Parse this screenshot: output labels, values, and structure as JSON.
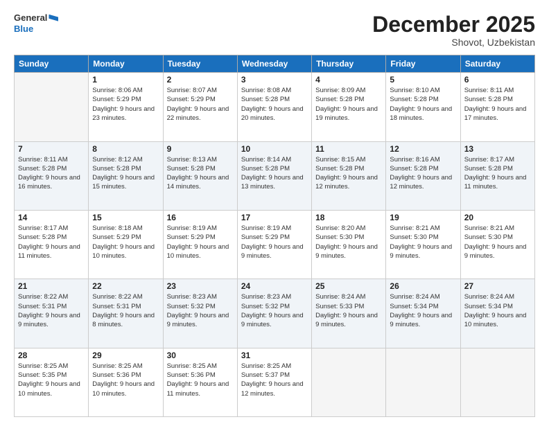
{
  "header": {
    "logo_general": "General",
    "logo_blue": "Blue",
    "month_title": "December 2025",
    "location": "Shovot, Uzbekistan"
  },
  "weekdays": [
    "Sunday",
    "Monday",
    "Tuesday",
    "Wednesday",
    "Thursday",
    "Friday",
    "Saturday"
  ],
  "weeks": [
    [
      {
        "num": "",
        "info": ""
      },
      {
        "num": "1",
        "info": "Sunrise: 8:06 AM\nSunset: 5:29 PM\nDaylight: 9 hours\nand 23 minutes."
      },
      {
        "num": "2",
        "info": "Sunrise: 8:07 AM\nSunset: 5:29 PM\nDaylight: 9 hours\nand 22 minutes."
      },
      {
        "num": "3",
        "info": "Sunrise: 8:08 AM\nSunset: 5:28 PM\nDaylight: 9 hours\nand 20 minutes."
      },
      {
        "num": "4",
        "info": "Sunrise: 8:09 AM\nSunset: 5:28 PM\nDaylight: 9 hours\nand 19 minutes."
      },
      {
        "num": "5",
        "info": "Sunrise: 8:10 AM\nSunset: 5:28 PM\nDaylight: 9 hours\nand 18 minutes."
      },
      {
        "num": "6",
        "info": "Sunrise: 8:11 AM\nSunset: 5:28 PM\nDaylight: 9 hours\nand 17 minutes."
      }
    ],
    [
      {
        "num": "7",
        "info": "Sunrise: 8:11 AM\nSunset: 5:28 PM\nDaylight: 9 hours\nand 16 minutes."
      },
      {
        "num": "8",
        "info": "Sunrise: 8:12 AM\nSunset: 5:28 PM\nDaylight: 9 hours\nand 15 minutes."
      },
      {
        "num": "9",
        "info": "Sunrise: 8:13 AM\nSunset: 5:28 PM\nDaylight: 9 hours\nand 14 minutes."
      },
      {
        "num": "10",
        "info": "Sunrise: 8:14 AM\nSunset: 5:28 PM\nDaylight: 9 hours\nand 13 minutes."
      },
      {
        "num": "11",
        "info": "Sunrise: 8:15 AM\nSunset: 5:28 PM\nDaylight: 9 hours\nand 12 minutes."
      },
      {
        "num": "12",
        "info": "Sunrise: 8:16 AM\nSunset: 5:28 PM\nDaylight: 9 hours\nand 12 minutes."
      },
      {
        "num": "13",
        "info": "Sunrise: 8:17 AM\nSunset: 5:28 PM\nDaylight: 9 hours\nand 11 minutes."
      }
    ],
    [
      {
        "num": "14",
        "info": "Sunrise: 8:17 AM\nSunset: 5:28 PM\nDaylight: 9 hours\nand 11 minutes."
      },
      {
        "num": "15",
        "info": "Sunrise: 8:18 AM\nSunset: 5:29 PM\nDaylight: 9 hours\nand 10 minutes."
      },
      {
        "num": "16",
        "info": "Sunrise: 8:19 AM\nSunset: 5:29 PM\nDaylight: 9 hours\nand 10 minutes."
      },
      {
        "num": "17",
        "info": "Sunrise: 8:19 AM\nSunset: 5:29 PM\nDaylight: 9 hours\nand 9 minutes."
      },
      {
        "num": "18",
        "info": "Sunrise: 8:20 AM\nSunset: 5:30 PM\nDaylight: 9 hours\nand 9 minutes."
      },
      {
        "num": "19",
        "info": "Sunrise: 8:21 AM\nSunset: 5:30 PM\nDaylight: 9 hours\nand 9 minutes."
      },
      {
        "num": "20",
        "info": "Sunrise: 8:21 AM\nSunset: 5:30 PM\nDaylight: 9 hours\nand 9 minutes."
      }
    ],
    [
      {
        "num": "21",
        "info": "Sunrise: 8:22 AM\nSunset: 5:31 PM\nDaylight: 9 hours\nand 9 minutes."
      },
      {
        "num": "22",
        "info": "Sunrise: 8:22 AM\nSunset: 5:31 PM\nDaylight: 9 hours\nand 8 minutes."
      },
      {
        "num": "23",
        "info": "Sunrise: 8:23 AM\nSunset: 5:32 PM\nDaylight: 9 hours\nand 9 minutes."
      },
      {
        "num": "24",
        "info": "Sunrise: 8:23 AM\nSunset: 5:32 PM\nDaylight: 9 hours\nand 9 minutes."
      },
      {
        "num": "25",
        "info": "Sunrise: 8:24 AM\nSunset: 5:33 PM\nDaylight: 9 hours\nand 9 minutes."
      },
      {
        "num": "26",
        "info": "Sunrise: 8:24 AM\nSunset: 5:34 PM\nDaylight: 9 hours\nand 9 minutes."
      },
      {
        "num": "27",
        "info": "Sunrise: 8:24 AM\nSunset: 5:34 PM\nDaylight: 9 hours\nand 10 minutes."
      }
    ],
    [
      {
        "num": "28",
        "info": "Sunrise: 8:25 AM\nSunset: 5:35 PM\nDaylight: 9 hours\nand 10 minutes."
      },
      {
        "num": "29",
        "info": "Sunrise: 8:25 AM\nSunset: 5:36 PM\nDaylight: 9 hours\nand 10 minutes."
      },
      {
        "num": "30",
        "info": "Sunrise: 8:25 AM\nSunset: 5:36 PM\nDaylight: 9 hours\nand 11 minutes."
      },
      {
        "num": "31",
        "info": "Sunrise: 8:25 AM\nSunset: 5:37 PM\nDaylight: 9 hours\nand 12 minutes."
      },
      {
        "num": "",
        "info": ""
      },
      {
        "num": "",
        "info": ""
      },
      {
        "num": "",
        "info": ""
      }
    ]
  ]
}
